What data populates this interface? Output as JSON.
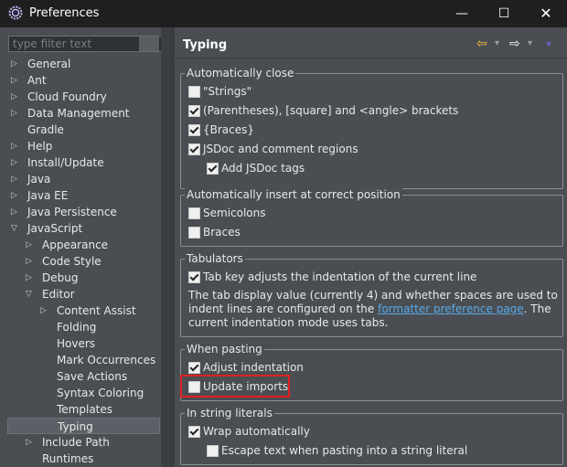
{
  "window": {
    "title": "Preferences",
    "minimize": "—",
    "maximize": "☐",
    "close": "✕"
  },
  "filter": {
    "placeholder": "type filter text"
  },
  "tree": [
    {
      "label": "General",
      "level": 0,
      "expand": "right"
    },
    {
      "label": "Ant",
      "level": 0,
      "expand": "right"
    },
    {
      "label": "Cloud Foundry",
      "level": 0,
      "expand": "right"
    },
    {
      "label": "Data Management",
      "level": 0,
      "expand": "right"
    },
    {
      "label": "Gradle",
      "level": 0,
      "expand": "none"
    },
    {
      "label": "Help",
      "level": 0,
      "expand": "right"
    },
    {
      "label": "Install/Update",
      "level": 0,
      "expand": "right"
    },
    {
      "label": "Java",
      "level": 0,
      "expand": "right"
    },
    {
      "label": "Java EE",
      "level": 0,
      "expand": "right"
    },
    {
      "label": "Java Persistence",
      "level": 0,
      "expand": "right"
    },
    {
      "label": "JavaScript",
      "level": 0,
      "expand": "down"
    },
    {
      "label": "Appearance",
      "level": 1,
      "expand": "right"
    },
    {
      "label": "Code Style",
      "level": 1,
      "expand": "right"
    },
    {
      "label": "Debug",
      "level": 1,
      "expand": "right"
    },
    {
      "label": "Editor",
      "level": 1,
      "expand": "down"
    },
    {
      "label": "Content Assist",
      "level": 2,
      "expand": "right"
    },
    {
      "label": "Folding",
      "level": 2,
      "expand": "none"
    },
    {
      "label": "Hovers",
      "level": 2,
      "expand": "none"
    },
    {
      "label": "Mark Occurrences",
      "level": 2,
      "expand": "none"
    },
    {
      "label": "Save Actions",
      "level": 2,
      "expand": "none"
    },
    {
      "label": "Syntax Coloring",
      "level": 2,
      "expand": "none"
    },
    {
      "label": "Templates",
      "level": 2,
      "expand": "none"
    },
    {
      "label": "Typing",
      "level": 2,
      "expand": "none",
      "selected": true
    },
    {
      "label": "Include Path",
      "level": 1,
      "expand": "right"
    },
    {
      "label": "Runtimes",
      "level": 1,
      "expand": "none"
    }
  ],
  "page": {
    "title": "Typing",
    "back_icon": "⇦",
    "forward_icon": "⇨",
    "dropdown_icon": "▾",
    "colors": {
      "back": "#f0c040",
      "menu": "#6a5ab8"
    }
  },
  "groups": {
    "auto_close": {
      "legend": "Automatically close",
      "options": [
        {
          "label": "\"Strings\"",
          "checked": false
        },
        {
          "label": "(Parentheses), [square] and <angle> brackets",
          "checked": true
        },
        {
          "label": "{Braces}",
          "checked": true
        },
        {
          "label": "JSDoc and comment regions",
          "checked": true
        },
        {
          "label": "Add JSDoc tags",
          "checked": true
        }
      ]
    },
    "auto_insert": {
      "legend": "Automatically insert at correct position",
      "options": [
        {
          "label": "Semicolons",
          "checked": false
        },
        {
          "label": "Braces",
          "checked": false
        }
      ]
    },
    "tabulators": {
      "legend": "Tabulators",
      "option": {
        "label": "Tab key adjusts the indentation of the current line",
        "checked": true
      },
      "text_before": "The tab display value (currently 4) and whether spaces are used to indent lines are configured on the ",
      "link": "formatter preference page",
      "text_after": ". The current indentation mode uses tabs."
    },
    "pasting": {
      "legend": "When pasting",
      "options": [
        {
          "label": "Adjust indentation",
          "checked": true
        },
        {
          "label": "Update imports",
          "checked": false
        }
      ]
    },
    "string_literals": {
      "legend": "In string literals",
      "options": [
        {
          "label": "Wrap automatically",
          "checked": true
        },
        {
          "label": "Escape text when pasting into a string literal",
          "checked": false
        }
      ]
    }
  }
}
